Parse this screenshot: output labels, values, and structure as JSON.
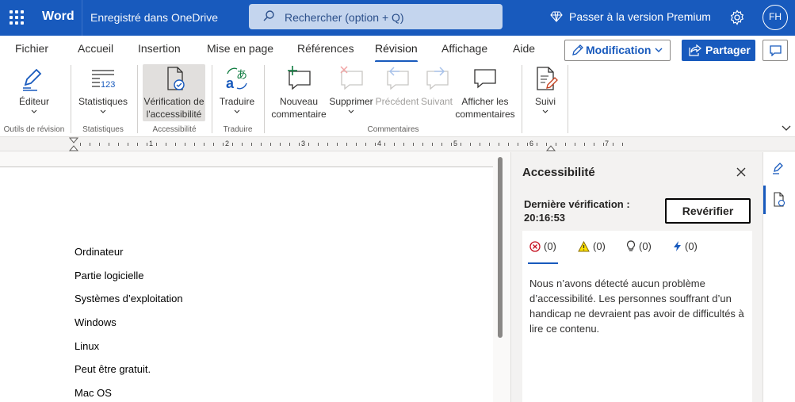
{
  "titlebar": {
    "app_name": "Word",
    "save_status": "Enregistré dans OneDrive",
    "search_placeholder": "Rechercher (option + Q)",
    "premium": "Passer à la version Premium",
    "user_initials": "FH",
    "bg_color": "#185abd"
  },
  "tabs": [
    "Fichier",
    "Accueil",
    "Insertion",
    "Mise en page",
    "Références",
    "Révision",
    "Affichage",
    "Aide"
  ],
  "active_tab": "Révision",
  "actions": {
    "modification": "Modification",
    "share": "Partager"
  },
  "ribbon": {
    "editor": "Éditeur",
    "stats": "Statistiques",
    "a11y_line1": "Vérification de",
    "a11y_line2": "l'accessibilité",
    "translate": "Traduire",
    "new_comment_1": "Nouveau",
    "new_comment_2": "commentaire",
    "delete": "Supprimer",
    "previous": "Précédent",
    "next": "Suivant",
    "show_comments_1": "Afficher les",
    "show_comments_2": "commentaires",
    "tracking": "Suivi",
    "groups": {
      "proofing": "Outils de révision",
      "stats": "Statistiques",
      "accessibility": "Accessibilité",
      "translate": "Traduire",
      "comments": "Commentaires"
    }
  },
  "ruler": [
    "1",
    "2",
    "3",
    "4",
    "5",
    "6",
    "7"
  ],
  "document": {
    "lines": [
      "Ordinateur",
      "Partie logicielle",
      "Systèmes d’exploitation",
      "Windows",
      "Linux",
      "Peut être gratuit.",
      "Mac OS"
    ]
  },
  "accessibility_pane": {
    "title": "Accessibilité",
    "last_check_label": "Dernière vérification :",
    "last_check_time": "20:16:53",
    "recheck": "Revérifier",
    "errors": "(0)",
    "warnings": "(0)",
    "tips": "(0)",
    "intelligent": "(0)",
    "message": "Nous n’avons détecté aucun problème d’accessibilité. Les personnes souffrant d’un handicap ne devraient pas avoir de difficultés à lire ce contenu."
  }
}
